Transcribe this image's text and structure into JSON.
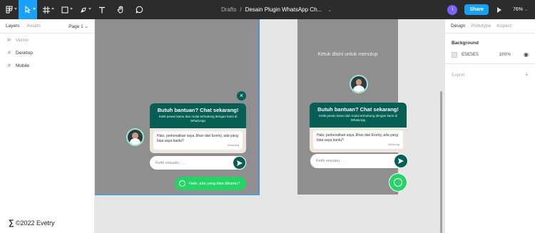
{
  "toolbar": {
    "breadcrumb_root": "Drafts",
    "separator": "/",
    "doc_title": "Desain Plugin WhatsApp Ch...",
    "user_initial": "I",
    "share_label": "Share",
    "zoom": "76%",
    "tools": [
      "main-menu-icon",
      "move-tool-icon",
      "frame-tool-icon",
      "shape-tool-icon",
      "pen-tool-icon",
      "text-tool-icon",
      "hand-tool-icon",
      "comment-tool-icon"
    ]
  },
  "left_panel": {
    "tab_layers": "Layers",
    "tab_assets": "Assets",
    "page_selector": "Page 1",
    "layers": [
      {
        "label": "Vector"
      },
      {
        "label": "Desktop"
      },
      {
        "label": "Mobile"
      }
    ],
    "footer": "©2022 Evetry"
  },
  "right_panel": {
    "tabs": [
      "Design",
      "Prototype",
      "Inspect"
    ],
    "background_heading": "Background",
    "background_color": "E5E5E5",
    "background_opacity": "100%",
    "export_label": "Export"
  },
  "widget": {
    "title": "Butuh bantuan? Chat sekarang!",
    "subtitle": "Ketik pesan kamu dan mulai terhubung dengan kami di WhatsApp",
    "message": "Halo, perkenalkan saya Jihan dari Evetry, ada yang bisa saya bantu?",
    "message_time": "Sekarang",
    "input_placeholder": "Ketik sesuatu . . .",
    "cta_label": "Halo, ada yang bisa dibantu?",
    "tap_to_close": "Ketuk disini untuk menutup",
    "close_symbol": "×"
  },
  "colors": {
    "toolbar": "#2c2c2c",
    "accent": "#18a0fb",
    "whatsapp_dark": "#075e54",
    "whatsapp_green": "#25d366",
    "overlay": "#8f8f8f"
  }
}
